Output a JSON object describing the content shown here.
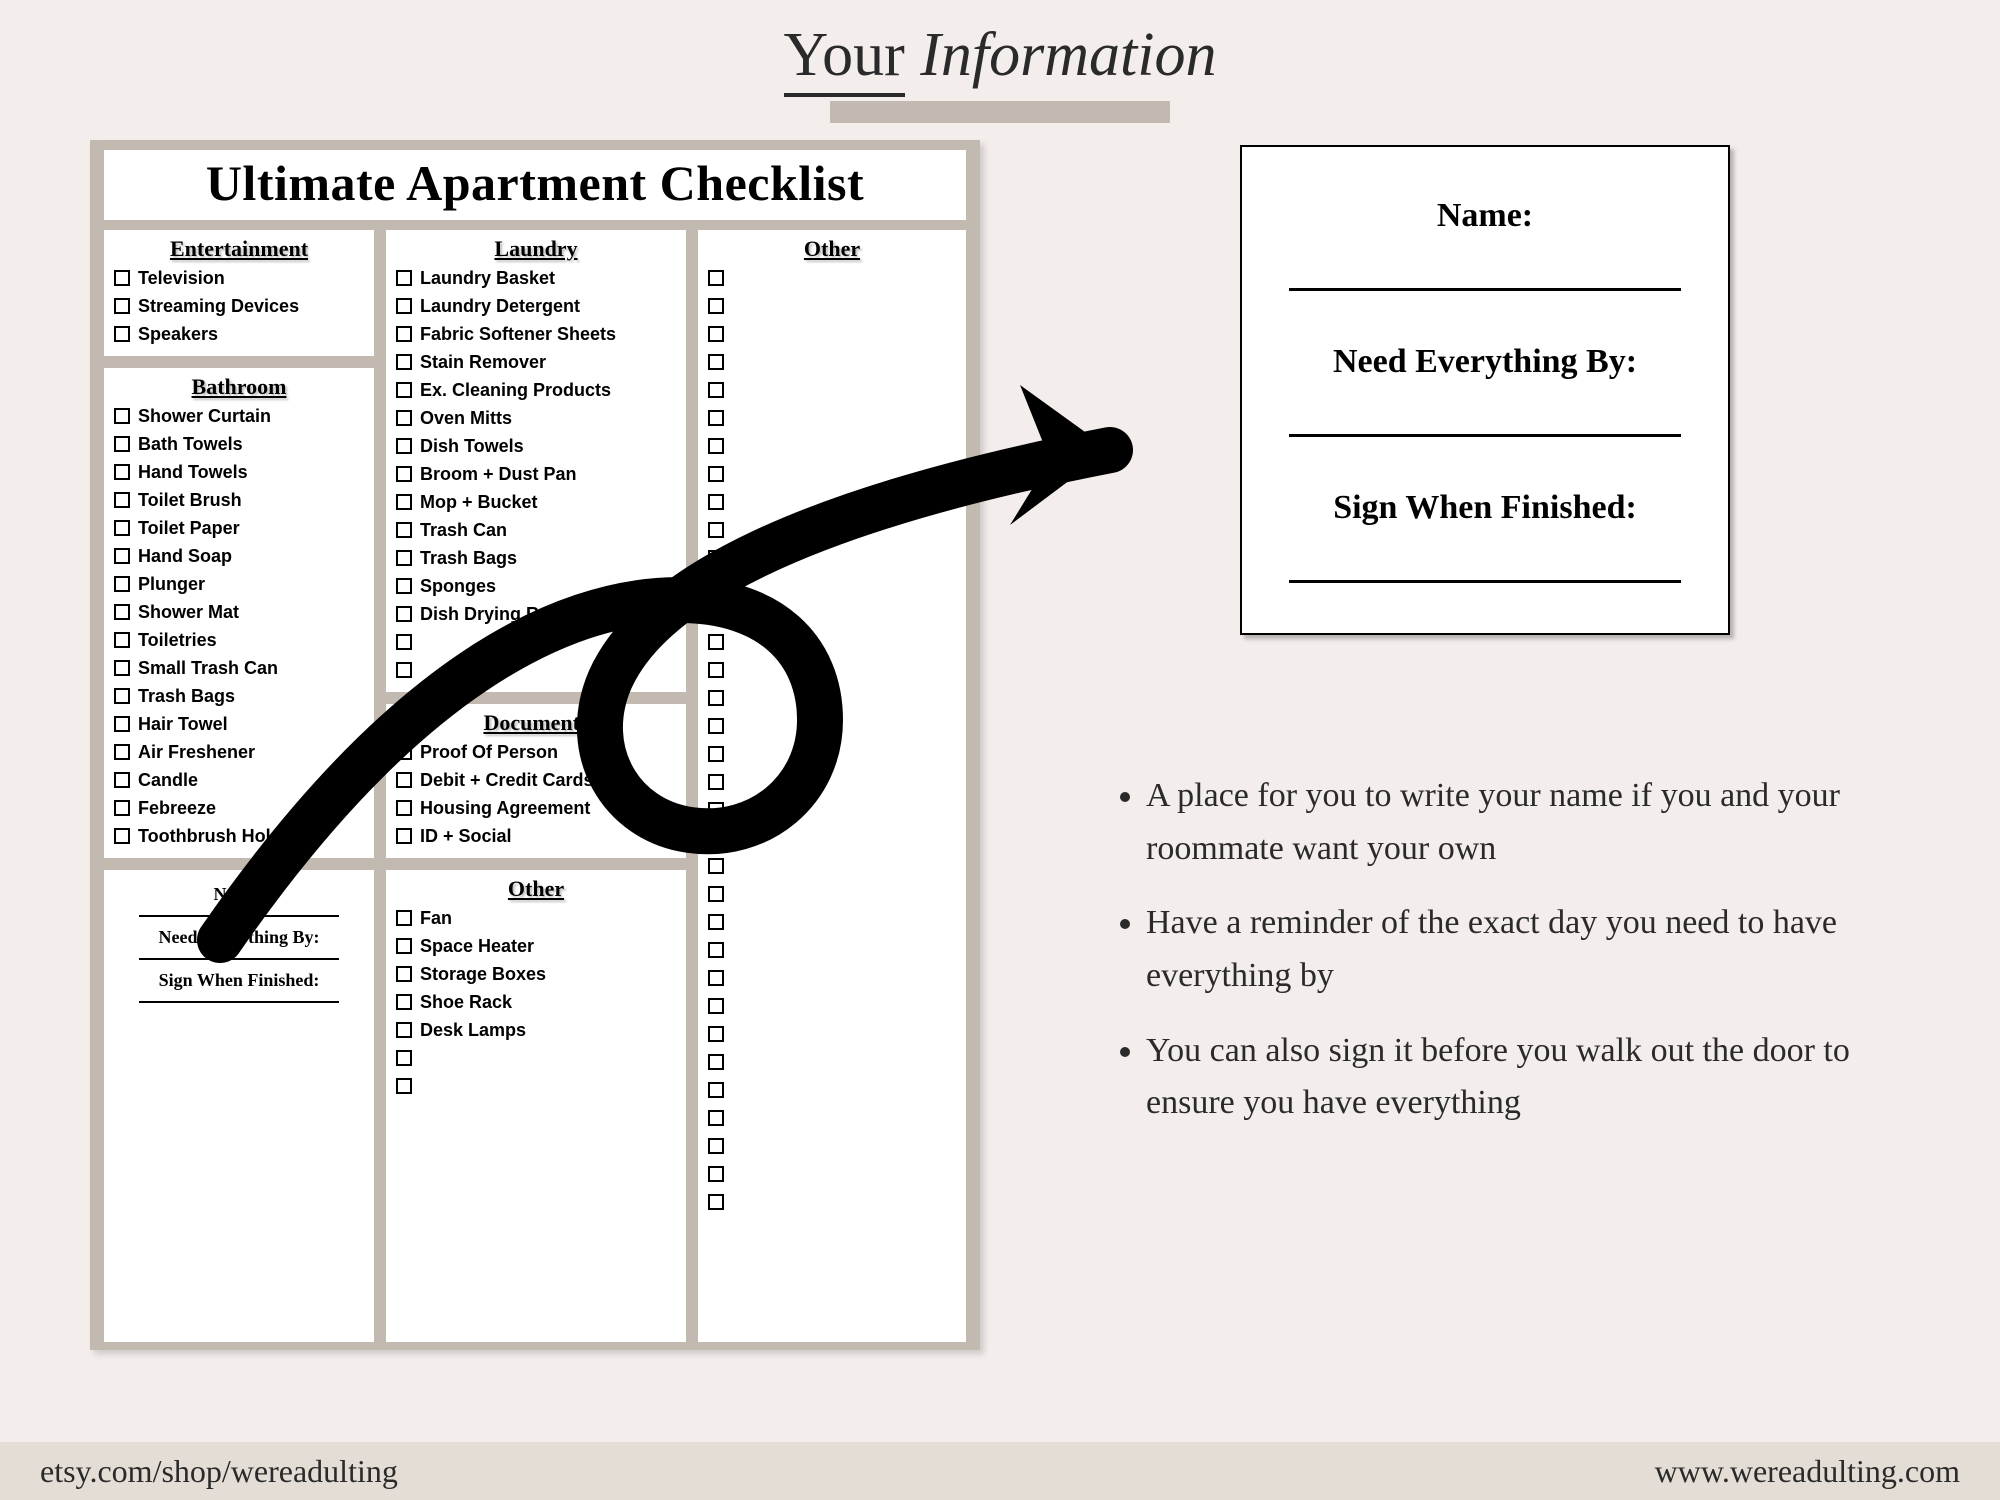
{
  "title": {
    "word1": "Your",
    "word2": "Information"
  },
  "checklist": {
    "heading": "Ultimate Apartment Checklist",
    "sections": {
      "entertainment": {
        "title": "Entertainment",
        "items": [
          "Television",
          "Streaming Devices",
          "Speakers"
        ]
      },
      "bathroom": {
        "title": "Bathroom",
        "items": [
          "Shower Curtain",
          "Bath Towels",
          "Hand Towels",
          "Toilet Brush",
          "Toilet Paper",
          "Hand Soap",
          "Plunger",
          "Shower Mat",
          "Toiletries",
          "Small Trash Can",
          "Trash Bags",
          "Hair Towel",
          "Air Freshener",
          "Candle",
          "Febreeze",
          "Toothbrush Holder"
        ]
      },
      "laundry": {
        "title": "Laundry",
        "items": [
          "Laundry Basket",
          "Laundry Detergent",
          "Fabric Softener Sheets",
          "Stain Remover",
          "Ex. Cleaning Products",
          "Oven Mitts",
          "Dish Towels",
          "Broom + Dust Pan",
          "Mop + Bucket",
          "Trash Can",
          "Trash Bags",
          "Sponges",
          "Dish Drying Rack"
        ],
        "blank": 2
      },
      "documents": {
        "title": "Documents",
        "items": [
          "Proof Of Person",
          "Debit + Credit Cards",
          "Housing Agreement",
          "ID + Social"
        ]
      },
      "otherSmall": {
        "title": "Other",
        "items": [
          "Fan",
          "Space Heater",
          "Storage Boxes",
          "Shoe Rack",
          "Desk Lamps"
        ],
        "blank": 2
      },
      "otherBig": {
        "title": "Other",
        "items": [],
        "blank": 34
      }
    },
    "infoMini": {
      "name": "Name:",
      "needBy": "Need Everything By:",
      "sign": "Sign When Finished:"
    }
  },
  "infoCard": {
    "name": "Name:",
    "needBy": "Need Everything By:",
    "sign": "Sign When Finished:"
  },
  "bullets": [
    "A place for you to write your name if you and your roommate want your own",
    "Have a reminder of the exact day you need to have everything by",
    "You can also sign it before you walk out the door to ensure you have everything"
  ],
  "footer": {
    "left": "etsy.com/shop/wereadulting",
    "right": "www.wereadulting.com"
  }
}
